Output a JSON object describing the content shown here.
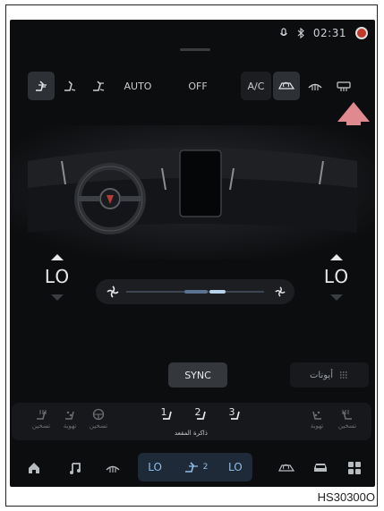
{
  "status": {
    "time": "02:31"
  },
  "climate": {
    "auto_label": "AUTO",
    "off_label": "OFF",
    "ac_label": "A/C",
    "left_temp": "LO",
    "right_temp": "LO",
    "fan_level": 0.72,
    "sync_label": "SYNC",
    "ionizer_label": "أيونات"
  },
  "seats": {
    "left_heat_label": "تسخين",
    "left_vent_label": "تهوية",
    "wheel_heat_label": "تسخين",
    "memory_label": "ذاكرة المقعد",
    "memory_1": "1",
    "memory_2": "2",
    "memory_3": "3",
    "right_vent_label": "تهوية",
    "right_heat_label": "تسخين"
  },
  "dock": {
    "left_temp": "LO",
    "right_temp": "LO",
    "center_badge": "2"
  },
  "figure_code": "HS30300O",
  "colors": {
    "accent": "#8fbde8",
    "arrow": "#e08a8f",
    "screen_bg": "#0c0d0f"
  }
}
